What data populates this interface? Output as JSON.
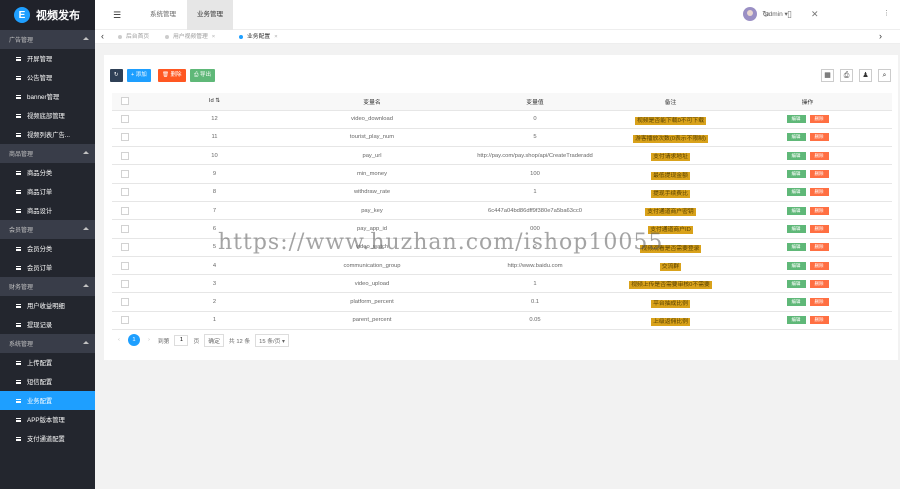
{
  "app": {
    "title": "视频发布",
    "logo_letter": "E"
  },
  "sidebar": {
    "groups": [
      {
        "title": "广告管理",
        "items": [
          "开屏管理",
          "公告管理",
          "banner管理",
          "视频底部管理",
          "视频列表广告..."
        ]
      },
      {
        "title": "商品管理",
        "items": [
          "商品分类",
          "商品订单",
          "商品设计"
        ]
      },
      {
        "title": "会员管理",
        "items": [
          "会员分类",
          "会员订单"
        ]
      },
      {
        "title": "财务管理",
        "items": [
          "用户收益明细",
          "提现记录"
        ]
      },
      {
        "title": "系统管理",
        "items": [
          "上传配置",
          "短信配置",
          "业务配置",
          "APP版本管理",
          "支付通道配置"
        ]
      }
    ],
    "active_item": "业务配置"
  },
  "topbar": {
    "menu_icon": "menu-icon",
    "tabs": [
      "系统管理",
      "业务管理"
    ],
    "active_tab": "业务管理",
    "icons": [
      "refresh-icon",
      "note-icon",
      "expand-icon"
    ],
    "username": "admin"
  },
  "page_tabs": {
    "items": [
      {
        "label": "后台首页",
        "close": ""
      },
      {
        "label": "用户视频管理",
        "close": "×"
      },
      {
        "label": "业务配置",
        "close": "×"
      }
    ]
  },
  "toolbar": {
    "refresh_label": "↻",
    "add_label": "+ 添加",
    "delete_label": "删除",
    "export_label": "导出",
    "right_icons": [
      "grid-icon",
      "print-icon",
      "user-icon",
      "search-icon"
    ]
  },
  "table": {
    "columns": [
      "Id ⇅",
      "变量名",
      "变量值",
      "备注",
      "操作"
    ],
    "rows": [
      {
        "id": "12",
        "name": "video_download",
        "value": "0",
        "remark": "视频是否能下载0不可下载"
      },
      {
        "id": "11",
        "name": "tourist_play_num",
        "value": "5",
        "remark": "游客播放次数(0表示不限制)"
      },
      {
        "id": "10",
        "name": "pay_url",
        "value": "http://pay.com/pay.shop/api/CreateTraderadd",
        "remark": "支付请求地址"
      },
      {
        "id": "9",
        "name": "min_money",
        "value": "100",
        "remark": "最低提现金额"
      },
      {
        "id": "8",
        "name": "withdraw_rate",
        "value": "1",
        "remark": "提现手续费比"
      },
      {
        "id": "7",
        "name": "pay_key",
        "value": "6c447a04bd86dff9f380e7a5ba63cc0",
        "remark": "支付通道商户密钥"
      },
      {
        "id": "6",
        "name": "pay_app_id",
        "value": "000",
        "remark": "支付通道商户ID"
      },
      {
        "id": "5",
        "name": "video_watch",
        "value": "0",
        "remark": "视频观看是否需要登录"
      },
      {
        "id": "4",
        "name": "communication_group",
        "value": "http://www.baidu.com",
        "remark": "交流群"
      },
      {
        "id": "3",
        "name": "video_upload",
        "value": "1",
        "remark": "视频上传是否需要审核0不需要"
      },
      {
        "id": "2",
        "name": "platform_percent",
        "value": "0.1",
        "remark": "平台抽成比例"
      },
      {
        "id": "1",
        "name": "parent_percent",
        "value": "0.05",
        "remark": "上级返佣比例"
      }
    ],
    "edit_label": "编辑",
    "delete_label": "删除"
  },
  "pagination": {
    "prev": "‹",
    "current": "1",
    "next": "›",
    "goto_label": "到第",
    "page_value": "1",
    "page_unit": "页",
    "confirm_label": "确定",
    "total_label": "共 12 条",
    "per_page": "15 条/页"
  },
  "watermark": "https://www.huzhan.com/ishop10055"
}
